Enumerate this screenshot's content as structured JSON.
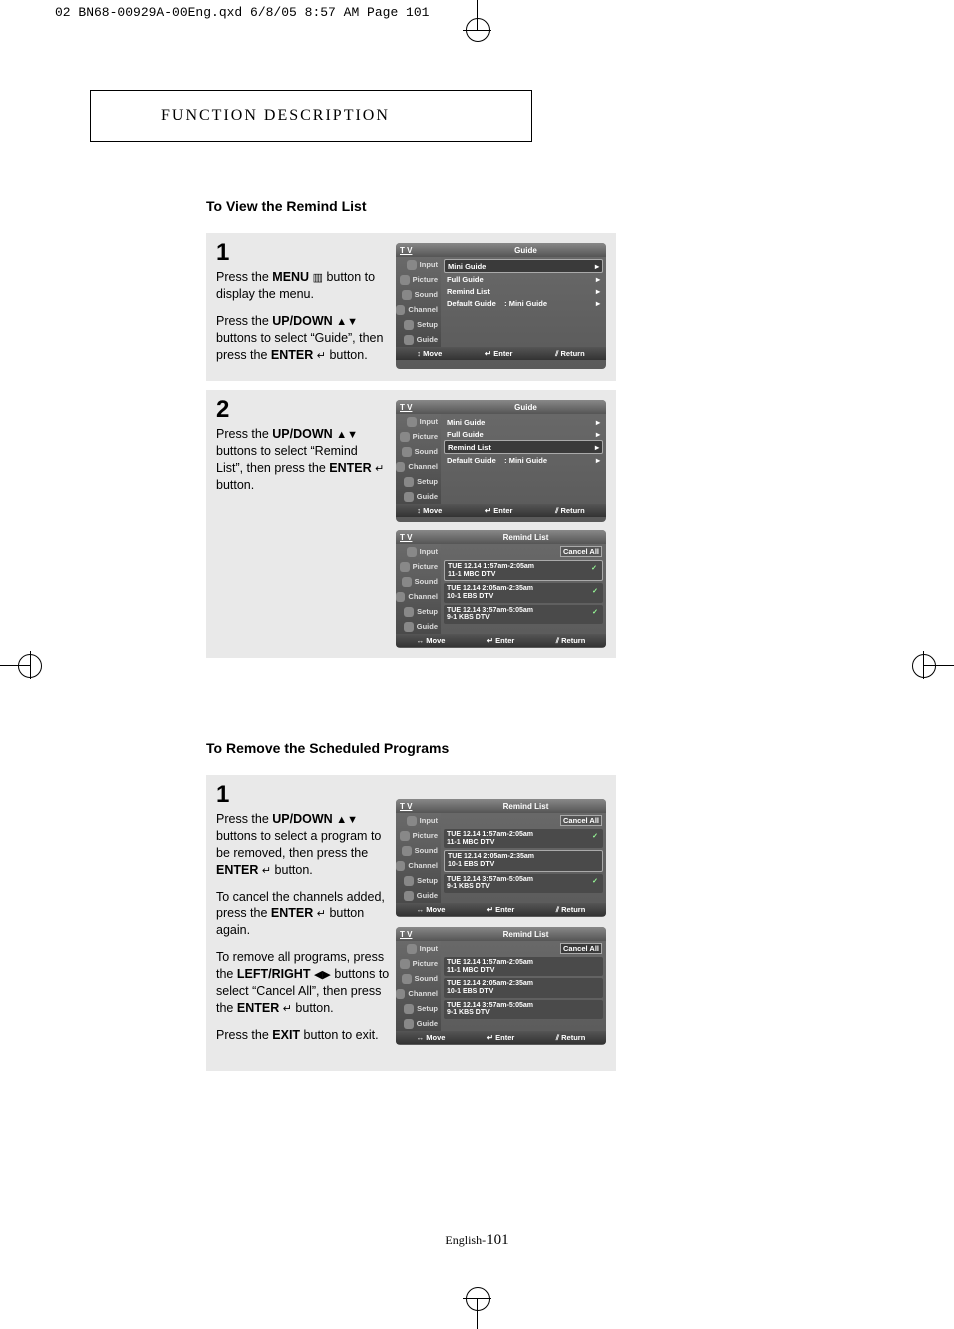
{
  "print_header": "02 BN68-00929A-00Eng.qxd  6/8/05 8:57 AM  Page 101",
  "func_desc": "FUNCTION DESCRIPTION",
  "sec1_title": "To View the Remind List",
  "sec2_title": "To Remove the Scheduled Programs",
  "step1": {
    "num": "1",
    "p1a": "Press the ",
    "p1b": "MENU",
    "p1c": " button to display the menu.",
    "p2a": "Press the ",
    "p2b": "UP/DOWN",
    "p2c": " buttons to select “Guide”, then press the ",
    "p2d": "ENTER",
    "p2e": " button."
  },
  "step2": {
    "num": "2",
    "p1a": "Press the ",
    "p1b": "UP/DOWN",
    "p1c": " buttons to select “Remind List”, then press the ",
    "p1d": "ENTER",
    "p1e": " button."
  },
  "step3": {
    "num": "1",
    "p1a": "Press the ",
    "p1b": "UP/DOWN",
    "p1c": " buttons to select a program to be removed, then press the ",
    "p1d": "ENTER",
    "p1e": " button.",
    "p2a": "To cancel the channels added, press the ",
    "p2b": "ENTER",
    "p2c": " button again.",
    "p3a": "To remove all programs, press the ",
    "p3b": "LEFT/RIGHT",
    "p3c": " buttons to select “Cancel All”, then press the ",
    "p3d": "ENTER",
    "p3e": " button.",
    "p4a": "Press the ",
    "p4b": "EXIT",
    "p4c": " button to exit."
  },
  "osd": {
    "tv": "T V",
    "side": [
      "Input",
      "Picture",
      "Sound",
      "Channel",
      "Setup",
      "Guide"
    ],
    "guide_title": "Guide",
    "guide_items": [
      "Mini Guide",
      "Full Guide",
      "Remind List"
    ],
    "default_guide_label": "Default Guide",
    "default_guide_value": ": Mini Guide",
    "remind_title": "Remind List",
    "cancel_all": "Cancel All",
    "reminds": [
      {
        "t": "TUE  12.14  1:57am-2:05am",
        "c": "11-1  MBC  DTV"
      },
      {
        "t": "TUE  12.14  2:05am-2:35am",
        "c": "10-1  EBS  DTV"
      },
      {
        "t": "TUE  12.14  3:57am-5:05am",
        "c": "9-1  KBS  DTV"
      }
    ],
    "foot_move_ud": "↕ Move",
    "foot_move_all": "↔ Move",
    "foot_enter": "↵ Enter",
    "foot_return": "⫽ Return"
  },
  "footer": {
    "lang": "English-",
    "num": "101"
  }
}
